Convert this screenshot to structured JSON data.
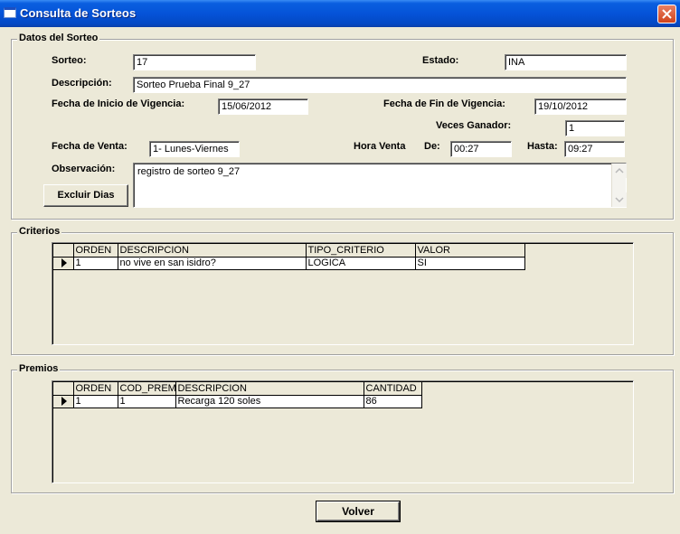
{
  "window": {
    "title": "Consulta de Sorteos"
  },
  "datos": {
    "legend": "Datos del Sorteo",
    "sorteo_label": "Sorteo:",
    "sorteo_value": "17",
    "estado_label": "Estado:",
    "estado_value": "INA",
    "descripcion_label": "Descripción:",
    "descripcion_value": "Sorteo Prueba Final 9_27",
    "fecha_inicio_label": "Fecha de Inicio de Vigencia:",
    "fecha_inicio_value": "15/06/2012",
    "fecha_fin_label": "Fecha de Fin de Vigencia:",
    "fecha_fin_value": "19/10/2012",
    "veces_ganador_label": "Veces Ganador:",
    "veces_ganador_value": "1",
    "fecha_venta_label": "Fecha de Venta:",
    "fecha_venta_value": "1- Lunes-Viernes",
    "hora_venta_label": "Hora Venta",
    "de_label": "De:",
    "de_value": "00:27",
    "hasta_label": "Hasta:",
    "hasta_value": "09:27",
    "observacion_label": "Observación:",
    "observacion_value": "registro de sorteo 9_27",
    "excluir_label": "Excluir Dias"
  },
  "criterios": {
    "legend": "Criterios",
    "columns": [
      "ORDEN",
      "DESCRIPCION",
      "TIPO_CRITERIO",
      "VALOR"
    ],
    "rows": [
      [
        "1",
        "no vive en san isidro?",
        "LOGICA",
        "SI"
      ]
    ]
  },
  "premios": {
    "legend": "Premios",
    "columns": [
      "ORDEN",
      "COD_PREMIO",
      "DESCRIPCION",
      "CANTIDAD"
    ],
    "rows": [
      [
        "1",
        "1",
        "Recarga 120 soles",
        "86"
      ]
    ]
  },
  "footer": {
    "volver_label": "Volver"
  },
  "icons": {
    "close": "close-icon",
    "row_pointer": "row-pointer-icon"
  },
  "colors": {
    "titlebar": "#0553d8",
    "close": "#d0431c",
    "face": "#ece9d8"
  }
}
